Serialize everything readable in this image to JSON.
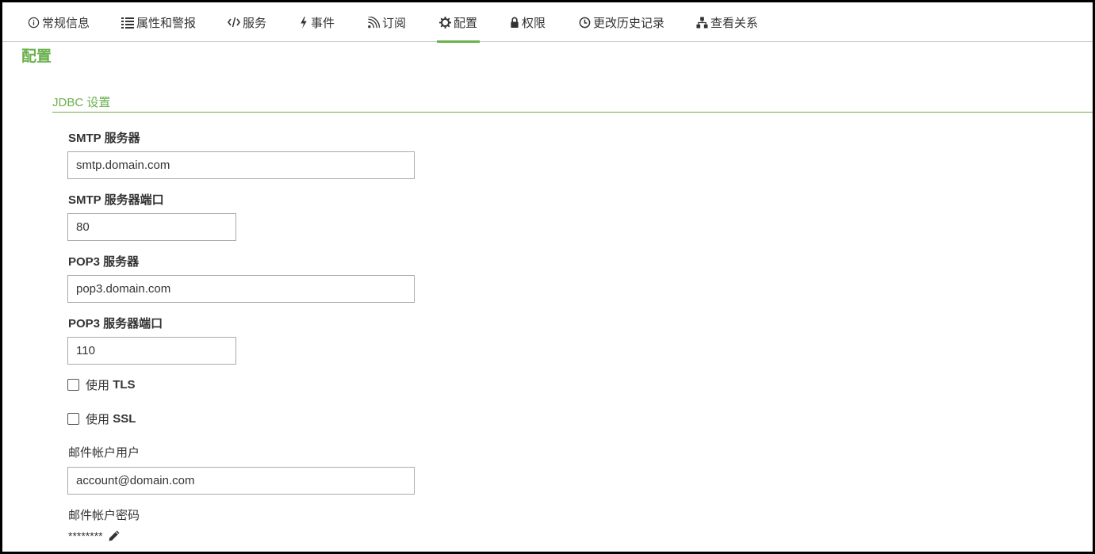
{
  "tabs": [
    {
      "label": "常规信息",
      "icon": "info-circle-icon"
    },
    {
      "label": "属性和警报",
      "icon": "list-icon"
    },
    {
      "label": "服务",
      "icon": "code-icon"
    },
    {
      "label": "事件",
      "icon": "lightning-icon"
    },
    {
      "label": "订阅",
      "icon": "rss-icon"
    },
    {
      "label": "配置",
      "icon": "gear-icon",
      "active": true
    },
    {
      "label": "权限",
      "icon": "lock-icon"
    },
    {
      "label": "更改历史记录",
      "icon": "clock-icon"
    },
    {
      "label": "查看关系",
      "icon": "hierarchy-icon"
    }
  ],
  "page": {
    "title": "配置"
  },
  "section": {
    "title": "JDBC 设置"
  },
  "fields": {
    "smtp_server": {
      "label": "SMTP 服务器",
      "value": "smtp.domain.com"
    },
    "smtp_port": {
      "label": "SMTP 服务器端口",
      "value": "80"
    },
    "pop3_server": {
      "label": "POP3 服务器",
      "value": "pop3.domain.com"
    },
    "pop3_port": {
      "label": "POP3 服务器端口",
      "value": "110"
    },
    "use_tls": {
      "prefix": "使用",
      "label": "TLS",
      "checked": false
    },
    "use_ssl": {
      "prefix": "使用",
      "label": "SSL",
      "checked": false
    },
    "mail_user": {
      "label": "邮件帐户用户",
      "value": "account@domain.com"
    },
    "mail_password": {
      "label": "邮件帐户密码",
      "value": "********",
      "edit_icon": "pencil-icon"
    }
  },
  "colors": {
    "accent": "#6ab04c",
    "text": "#333333",
    "border": "#a9a9a9"
  }
}
